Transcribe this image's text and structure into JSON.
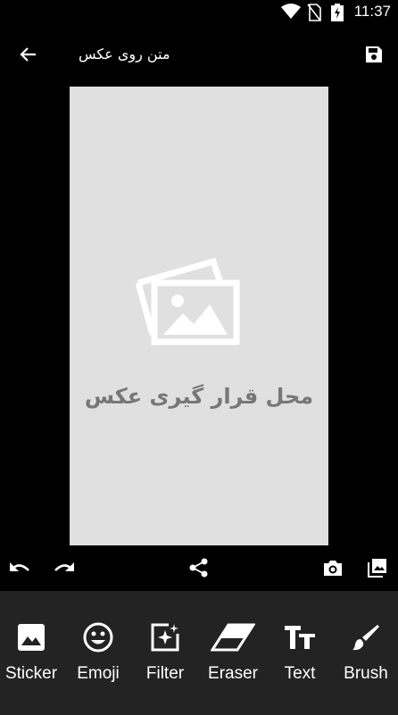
{
  "status_bar": {
    "time": "11:37",
    "icons": [
      "wifi-icon",
      "no-sim-icon",
      "battery-charging-icon"
    ]
  },
  "toolbar": {
    "title": "متن روی عکس",
    "back_icon": "arrow-back-icon",
    "save_icon": "save-icon"
  },
  "canvas": {
    "placeholder_text": "محل قرار گیری عکس",
    "placeholder_icon": "photos-icon"
  },
  "action_bar": {
    "icons": [
      "undo-icon",
      "redo-icon",
      "share-icon",
      "camera-icon",
      "gallery-icon"
    ]
  },
  "tools": [
    {
      "label": "Sticker",
      "icon": "image-icon"
    },
    {
      "label": "Emoji",
      "icon": "smiley-icon"
    },
    {
      "label": "Filter",
      "icon": "filter-icon"
    },
    {
      "label": "Eraser",
      "icon": "eraser-icon"
    },
    {
      "label": "Text",
      "icon": "text-icon"
    },
    {
      "label": "Brush",
      "icon": "brush-icon"
    }
  ],
  "colors": {
    "background": "#000000",
    "canvas": "#e0e0e0",
    "placeholder": "#777777",
    "bottom_panel": "#232323"
  }
}
